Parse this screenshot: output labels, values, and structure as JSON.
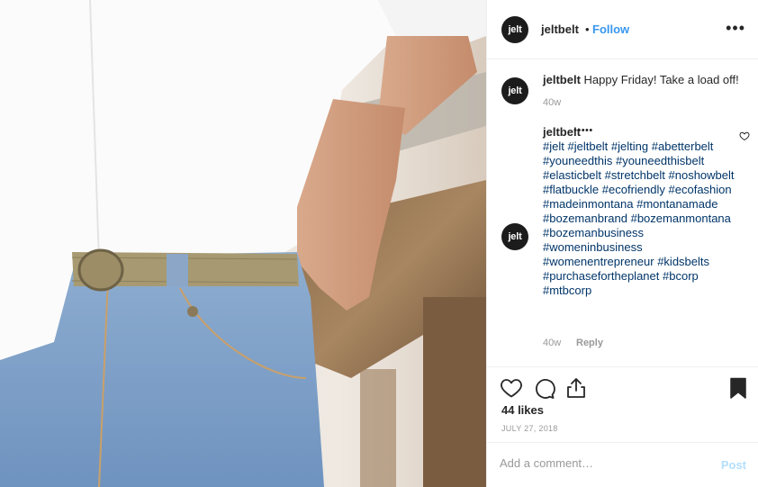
{
  "photo": {
    "alt": ""
  },
  "header": {
    "avatar_text": "jelt",
    "username": "jeltbelt",
    "separator": "•",
    "follow_label": "Follow",
    "more_label": "•••"
  },
  "caption": {
    "avatar_text": "jelt",
    "username": "jeltbelt",
    "text": "Happy Friday! Take a load off!",
    "time": "40w"
  },
  "comment": {
    "avatar_text": "jelt",
    "username": "jeltbelt",
    "dots": "•••••",
    "hashtags": [
      "#jelt",
      "#jeltbelt",
      "#jelting",
      "#abetterbelt",
      "#youneedthis",
      "#youneedthisbelt",
      "#elasticbelt",
      "#stretchbelt",
      "#noshowbelt",
      "#flatbuckle",
      "#ecofriendly",
      "#ecofashion",
      "#madeinmontana",
      "#montanamade",
      "#bozemanbrand",
      "#bozemanmontana",
      "#bozemanbusiness",
      "#womeninbusiness",
      "#womenentrepreneur",
      "#kidsbelts",
      "#purchasefortheplanet",
      "#bcorp",
      "#mtbcorp"
    ],
    "time": "40w",
    "reply_label": "Reply"
  },
  "actions": {
    "likes": "44 likes",
    "date": "JULY 27, 2018"
  },
  "add_comment": {
    "placeholder": "Add a comment…",
    "post_label": "Post"
  }
}
